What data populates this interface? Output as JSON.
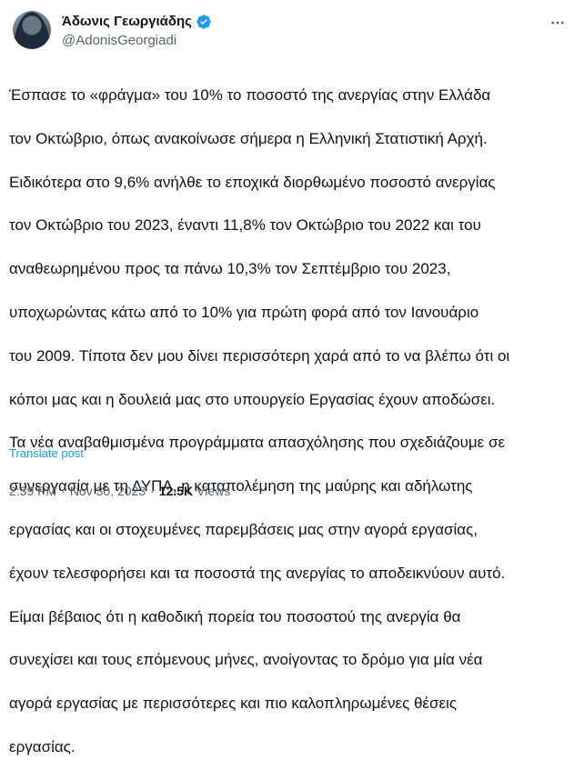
{
  "author": {
    "display_name": "Άδωνις Γεωργιάδης",
    "handle": "@AdonisGeorgiadi",
    "verified_color": "#1d9bf0"
  },
  "tweet": {
    "lines": [
      "Έσπασε το «φράγμα» του 10% το ποσοστό της ανεργίας στην Ελλάδα",
      "τον Οκτώβριο, όπως ανακοίνωσε σήμερα η Ελληνική Στατιστική Αρχή.",
      "Ειδικότερα στο 9,6% ανήλθε το εποχικά διορθωμένο ποσοστό ανεργίας",
      "τον Οκτώβριο του 2023, έναντι 11,8% τον Οκτώβριο του 2022 και του",
      "αναθεωρημένου προς τα πάνω 10,3% τον Σεπτέμβριο του 2023,",
      "υποχωρώντας κάτω από το 10% για πρώτη φορά από τον Ιανουάριο",
      "του 2009. Τίποτα δεν μου δίνει περισσότερη χαρά από το να βλέπω ότι οι",
      "κόποι μας και η δουλειά μας στο υπουργείο Εργασίας έχουν αποδώσει.",
      "Τα νέα αναβαθμισμένα προγράμματα απασχόλησης που σχεδιάζουμε σε",
      "συνεργασία με τη ΔΥΠΑ, η καταπολέμηση της μαύρης και αδήλωτης",
      "εργασίας και οι στοχευμένες παρεμβάσεις μας στην αγορά εργασίας,",
      "έχουν τελεσφορήσει και τα ποσοστά της ανεργίας το αποδεικνύουν αυτό.",
      "Είμαι βέβαιος ότι η καθοδική πορεία του ποσοστού της ανεργία θα",
      "συνεχίσει και τους επόμενους μήνες, ανοίγοντας το δρόμο για μία νέα",
      "αγορά εργασίας με περισσότερες και πιο καλοπληρωμένες θέσεις",
      "εργασίας."
    ],
    "translate_label": "Translate post",
    "time": "2:39 PM",
    "separator": "·",
    "date": "Nov 30, 2023",
    "views_count": "12.5K",
    "views_label": "Views"
  },
  "icons": {
    "more": "more-horizontal-icon",
    "verified": "verified-badge-icon"
  }
}
